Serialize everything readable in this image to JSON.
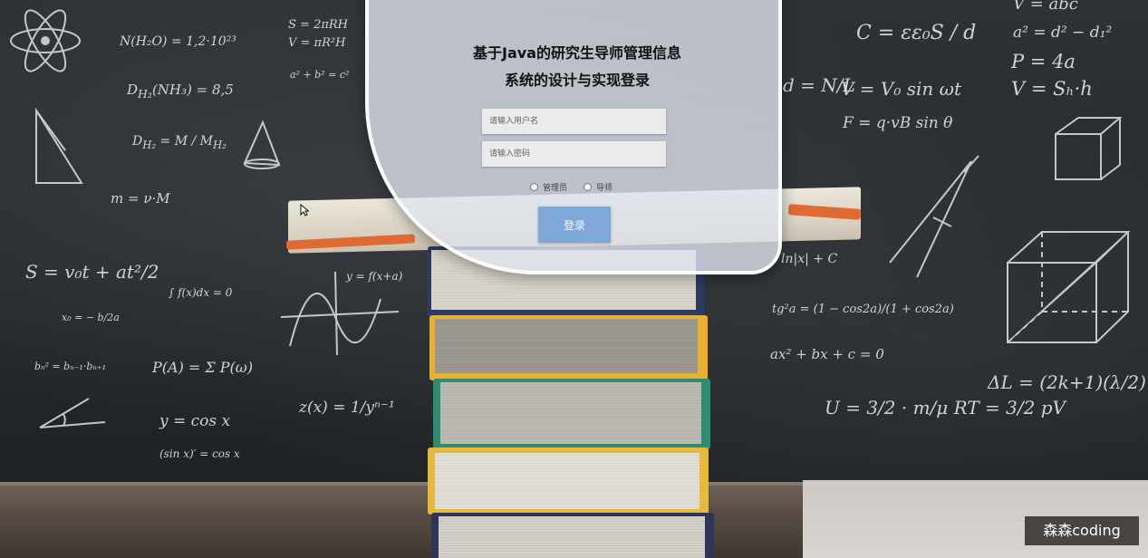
{
  "login": {
    "title_line1": "基于Java的研究生导师管理信息",
    "title_line2": "系统的设计与实现登录",
    "username_placeholder": "请输入用户名",
    "password_placeholder": "请输入密码",
    "roles": [
      {
        "label": "管理员",
        "selected": false
      },
      {
        "label": "导师",
        "selected": false
      }
    ],
    "login_button": "登录"
  },
  "watermark": "森森coding",
  "colors": {
    "panel_bg": "#dee4ee",
    "button_bg": "#7fa7d8",
    "chalkboard": "#2a2d30"
  }
}
